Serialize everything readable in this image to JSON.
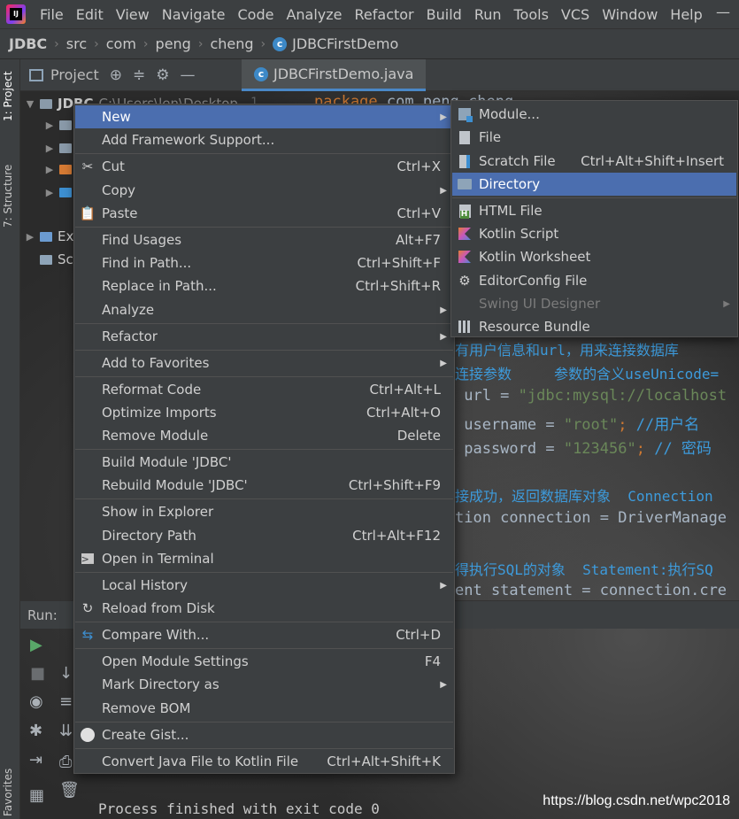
{
  "menubar": {
    "app_icon_text": "IJ",
    "items": [
      "File",
      "Edit",
      "View",
      "Navigate",
      "Code",
      "Analyze",
      "Refactor",
      "Build",
      "Run",
      "Tools",
      "VCS",
      "Window",
      "Help"
    ],
    "window_minimize": "—"
  },
  "breadcrumb": {
    "items": [
      "JDBC",
      "src",
      "com",
      "peng",
      "cheng",
      "JDBCFirstDemo"
    ]
  },
  "left_strip": {
    "project_tab": "1: Project",
    "structure_tab": "7: Structure",
    "favorites_tab": "Favorites"
  },
  "project_panel": {
    "title": "Project",
    "root_label": "JDBC",
    "root_path": "C:\\Users\\len\\Desktop",
    "external_libs": "Ex",
    "scratches": "Sc"
  },
  "editor": {
    "tab_title": "JDBCFirstDemo.java",
    "line_number": "1",
    "code_line1_kw": "package",
    "code_line1_rest": " com.peng.cheng",
    "comment_userinfo": "有用户信息和url，用来连接数据库",
    "comment_params": "连接参数     参数的含义useUnicode=",
    "url_kw": " url = ",
    "url_value": "\"jdbc:mysql://localhost",
    "username_kw": " username = ",
    "username_value": "\"root\"",
    "username_comment": " //用户名",
    "password_kw": " password = ",
    "password_value": "\"123456\"",
    "password_comment": " // 密码",
    "comment_connection": "接成功，返回数据库对象  Connection",
    "connection_line": "tion connection = DriverManage",
    "comment_statement": "得执行SQL的对象  Statement:执行SQ",
    "statement_line": "ent statement = connection.cre"
  },
  "run_panel": {
    "title": "Run:",
    "console_output": "Process finished with exit code 0"
  },
  "watermark": "https://blog.csdn.net/wpc2018",
  "context_menu": {
    "items": [
      {
        "label": "New",
        "shortcut": "",
        "submenu": true,
        "selected": true
      },
      {
        "label": "Add Framework Support...",
        "shortcut": ""
      },
      {
        "label": "Cut",
        "shortcut": "Ctrl+X",
        "icon": "scissors-icon"
      },
      {
        "label": "Copy",
        "shortcut": "",
        "submenu": true
      },
      {
        "label": "Paste",
        "shortcut": "Ctrl+V",
        "icon": "clipboard-icon"
      },
      {
        "label": "Find Usages",
        "shortcut": "Alt+F7"
      },
      {
        "label": "Find in Path...",
        "shortcut": "Ctrl+Shift+F"
      },
      {
        "label": "Replace in Path...",
        "shortcut": "Ctrl+Shift+R"
      },
      {
        "label": "Analyze",
        "shortcut": "",
        "submenu": true
      },
      {
        "label": "Refactor",
        "shortcut": "",
        "submenu": true
      },
      {
        "label": "Add to Favorites",
        "shortcut": "",
        "submenu": true
      },
      {
        "label": "Reformat Code",
        "shortcut": "Ctrl+Alt+L"
      },
      {
        "label": "Optimize Imports",
        "shortcut": "Ctrl+Alt+O"
      },
      {
        "label": "Remove Module",
        "shortcut": "Delete"
      },
      {
        "label": "Build Module 'JDBC'",
        "shortcut": ""
      },
      {
        "label": "Rebuild Module 'JDBC'",
        "shortcut": "Ctrl+Shift+F9"
      },
      {
        "label": "Show in Explorer",
        "shortcut": ""
      },
      {
        "label": "Directory Path",
        "shortcut": "Ctrl+Alt+F12"
      },
      {
        "label": "Open in Terminal",
        "shortcut": "",
        "icon": "terminal-icon"
      },
      {
        "label": "Local History",
        "shortcut": "",
        "submenu": true
      },
      {
        "label": "Reload from Disk",
        "shortcut": "",
        "icon": "reload-icon"
      },
      {
        "label": "Compare With...",
        "shortcut": "Ctrl+D",
        "icon": "compare-icon"
      },
      {
        "label": "Open Module Settings",
        "shortcut": "F4"
      },
      {
        "label": "Mark Directory as",
        "shortcut": "",
        "submenu": true
      },
      {
        "label": "Remove BOM",
        "shortcut": ""
      },
      {
        "label": "Create Gist...",
        "shortcut": "",
        "icon": "github-icon"
      },
      {
        "label": "Convert Java File to Kotlin File",
        "shortcut": "Ctrl+Alt+Shift+K"
      }
    ]
  },
  "new_submenu": {
    "items": [
      {
        "label": "Module...",
        "shortcut": "",
        "icon": "module-icon"
      },
      {
        "label": "File",
        "shortcut": "",
        "icon": "file-icon"
      },
      {
        "label": "Scratch File",
        "shortcut": "Ctrl+Alt+Shift+Insert",
        "icon": "scratch-file-icon"
      },
      {
        "label": "Directory",
        "shortcut": "",
        "icon": "folder-icon",
        "selected": true
      },
      {
        "label": "HTML File",
        "shortcut": "",
        "icon": "html-file-icon"
      },
      {
        "label": "Kotlin Script",
        "shortcut": "",
        "icon": "kotlin-icon"
      },
      {
        "label": "Kotlin Worksheet",
        "shortcut": "",
        "icon": "kotlin-icon"
      },
      {
        "label": "EditorConfig File",
        "shortcut": "",
        "icon": "gear-icon"
      },
      {
        "label": "Swing UI Designer",
        "shortcut": "",
        "submenu": true,
        "disabled": true
      },
      {
        "label": "Resource Bundle",
        "shortcut": "",
        "icon": "resource-bundle-icon"
      }
    ]
  },
  "colors": {
    "menu_bg": "#3c3f41",
    "selection": "#4b6eaf",
    "editor_bg": "#2b2b2b",
    "keyword": "#cc7832",
    "string": "#6a8759"
  }
}
